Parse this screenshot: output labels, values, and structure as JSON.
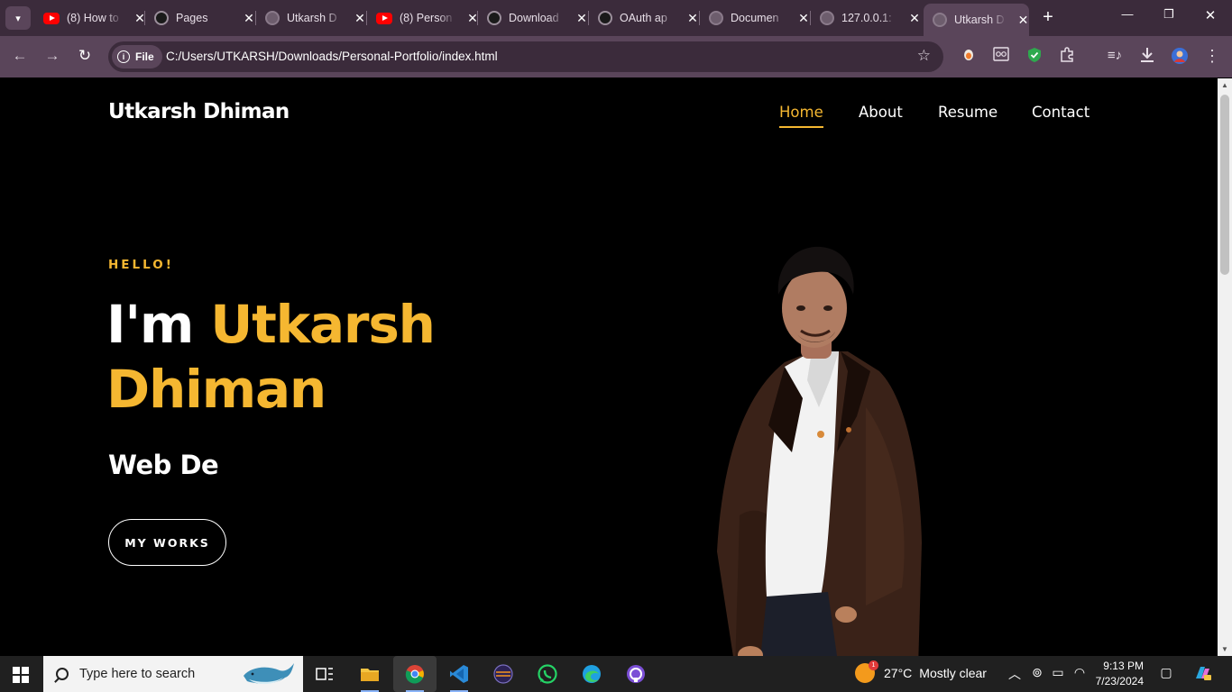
{
  "browser": {
    "tabs": [
      {
        "title": "(8) How to",
        "favicon": "youtube-icon"
      },
      {
        "title": "Pages",
        "favicon": "github-icon"
      },
      {
        "title": "Utkarsh D",
        "favicon": "globe-icon"
      },
      {
        "title": "(8) Person",
        "favicon": "youtube-icon"
      },
      {
        "title": "Download",
        "favicon": "github-icon"
      },
      {
        "title": "OAuth ap",
        "favicon": "github-icon"
      },
      {
        "title": "Documen",
        "favicon": "globe-icon"
      },
      {
        "title": "127.0.0.1:",
        "favicon": "globe-icon"
      },
      {
        "title": "Utkarsh D",
        "favicon": "globe-icon",
        "active": true
      }
    ],
    "address": {
      "chip": "File",
      "url": "C:/Users/UTKARSH/Downloads/Personal-Portfolio/index.html"
    }
  },
  "page": {
    "brand": "Utkarsh Dhiman",
    "nav": [
      {
        "label": "Home",
        "active": true
      },
      {
        "label": "About"
      },
      {
        "label": "Resume"
      },
      {
        "label": "Contact"
      }
    ],
    "hero": {
      "eyebrow": "HELLO!",
      "intro": "I'm",
      "first_name": "Utkarsh",
      "last_name": "Dhiman",
      "typed_role": "Web De",
      "cta": "MY WORKS"
    },
    "colors": {
      "accent": "#f5b731",
      "background": "#000000"
    }
  },
  "taskbar": {
    "search_placeholder": "Type here to search",
    "weather": {
      "temp": "27°C",
      "condition": "Mostly clear",
      "badge": "1"
    },
    "time": "9:13 PM",
    "date": "7/23/2024"
  }
}
